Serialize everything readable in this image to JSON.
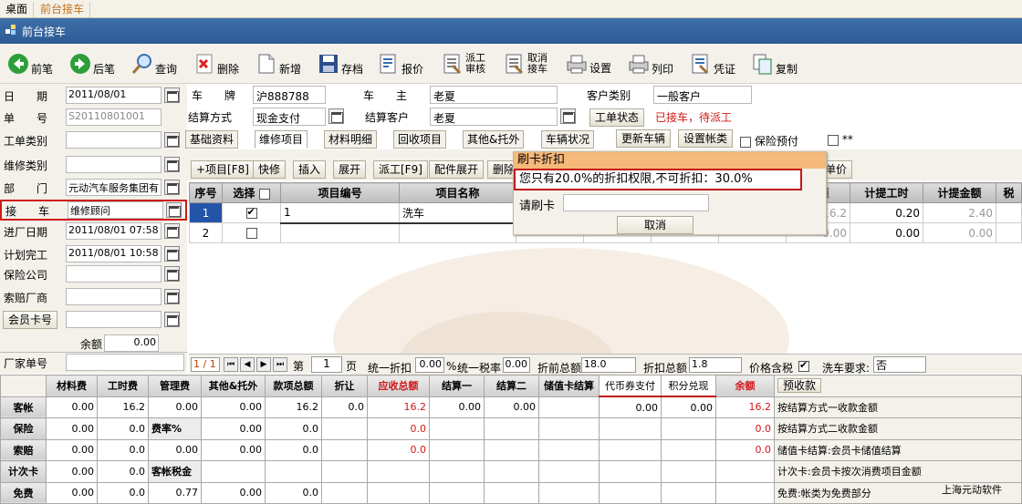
{
  "topbar": {
    "tab1": "桌面",
    "tab2": "前台接车"
  },
  "window": {
    "title": "前台接车"
  },
  "toolbar": {
    "prev": "前笔",
    "next": "后笔",
    "query": "查询",
    "delete": "删除",
    "add": "新增",
    "save": "存档",
    "quote": "报价",
    "dispatch_l1": "派工",
    "dispatch_l2": "审核",
    "cancel_l1": "取消",
    "cancel_l2": "接车",
    "settings": "设置",
    "print": "列印",
    "voucher": "凭证",
    "copy": "复制"
  },
  "left": {
    "date_label": "日　　期",
    "date": "2011/08/01",
    "no_label": "单　　号",
    "no": "S20110801001",
    "order_type_label": "工单类别",
    "repair_type_label": "维修类别",
    "dept_label": "部　　门",
    "dept": "元动汽车服务集团有",
    "receiver_label": "接　　车",
    "receiver": "维修顾问",
    "in_date_label": "进厂日期",
    "in_date": "2011/08/01 07:58",
    "plan_label": "计划完工",
    "plan": "2011/08/01 10:58",
    "insurer_label": "保险公司",
    "claim_label": "索赔厂商",
    "member_btn": "会员卡号",
    "balance_label": "余额",
    "balance": "0.00",
    "factory_no_label": "厂家单号"
  },
  "header": {
    "plate_label": "车　　牌",
    "plate": "沪888788",
    "owner_label": "车　　主",
    "owner": "老夏",
    "cust_type_label": "客户类别",
    "cust_type": "一般客户",
    "pay_label": "结算方式",
    "pay": "现金支付",
    "settle_cust_label": "结算客户",
    "settle_cust": "老夏",
    "status_btn": "工单状态",
    "status": "已接车，待派工"
  },
  "tabs": [
    "基础资料",
    "维修项目",
    "材料明细",
    "回收项目",
    "其他&托外",
    "车辆状况"
  ],
  "tab_buttons": {
    "update_vehicle": "更新车辆",
    "set_account": "设置帐类",
    "insurance_prepay": "保险预付",
    "star": "**"
  },
  "action_buttons": [
    "+项目[F8]",
    "快修",
    "插入",
    "展开",
    "派工[F9]",
    "配件展开",
    "删除"
  ],
  "unit_price_btn": "单价",
  "grid": {
    "headers": [
      "序号",
      "选择",
      "项目编号",
      "项目名称",
      "",
      "",
      "",
      "",
      "金额",
      "计提工时",
      "计提金额",
      "税"
    ],
    "rows": [
      {
        "no": "1",
        "checked": true,
        "code": "1",
        "name": "洗车",
        "amt": "16.2",
        "hours": "0.20",
        "commission": "2.40"
      },
      {
        "no": "2",
        "checked": false,
        "code": "",
        "name": "",
        "amt": "0.00",
        "hours": "0.00",
        "commission": "0.00"
      }
    ]
  },
  "popup": {
    "title": "刷卡折扣",
    "message": "您只有20.0%的折扣权限,不可折扣：30.0%",
    "card_label": "请刷卡",
    "cancel": "取消"
  },
  "pager": {
    "pos": "1 / 1",
    "page_label": "第",
    "page": "1",
    "page_unit": "页",
    "discount_label": "统一折扣",
    "discount": "0.00",
    "pct": "%",
    "tax_label": "统一税率",
    "tax": "0.00",
    "pre_total_label": "折前总额",
    "pre_total": "18.0",
    "post_total_label": "折扣总额",
    "post_total": "1.8",
    "price_tax_label": "价格含税",
    "wash_label": "洗车要求:",
    "wash": "否"
  },
  "summary": {
    "headers": [
      "材料费",
      "工时费",
      "管理费",
      "其他&托外",
      "款项总额",
      "折让",
      "应收总额",
      "结算一",
      "结算二",
      "储值卡结算",
      "代币券支付",
      "积分兑现",
      "余额",
      "预收款"
    ],
    "rows": [
      {
        "label": "客帐",
        "cells": [
          "0.00",
          "16.2",
          "0.00",
          "0.00",
          "16.2",
          "0.0",
          "16.2",
          "0.00",
          "0.00",
          "",
          "0.00",
          "0.00",
          "16.2"
        ],
        "note": "按结算方式一收款金额"
      },
      {
        "label": "保险",
        "cells": [
          "0.00",
          "0.0",
          "费率%",
          "0.00",
          "0.0",
          "",
          "0.0",
          "",
          "",
          "",
          "",
          "",
          "0.0"
        ],
        "note": "按结算方式二收款金额"
      },
      {
        "label": "索赔",
        "cells": [
          "0.00",
          "0.0",
          "0.00",
          "0.00",
          "0.0",
          "",
          "0.0",
          "",
          "",
          "",
          "",
          "",
          "0.0"
        ],
        "note": "储值卡结算:会员卡储值结算"
      },
      {
        "label": "计次卡",
        "cells": [
          "0.00",
          "0.0",
          "客帐税金",
          "",
          "",
          "",
          "",
          "",
          "",
          "",
          "",
          "",
          ""
        ],
        "note": "计次卡:会员卡按次消费项目金额"
      },
      {
        "label": "免费",
        "cells": [
          "0.00",
          "0.0",
          "0.77",
          "0.00",
          "0.0",
          "",
          "",
          "",
          "",
          "",
          "",
          "",
          ""
        ],
        "note": "免费:帐类为免费部分"
      }
    ],
    "company": "上海元动软件"
  }
}
